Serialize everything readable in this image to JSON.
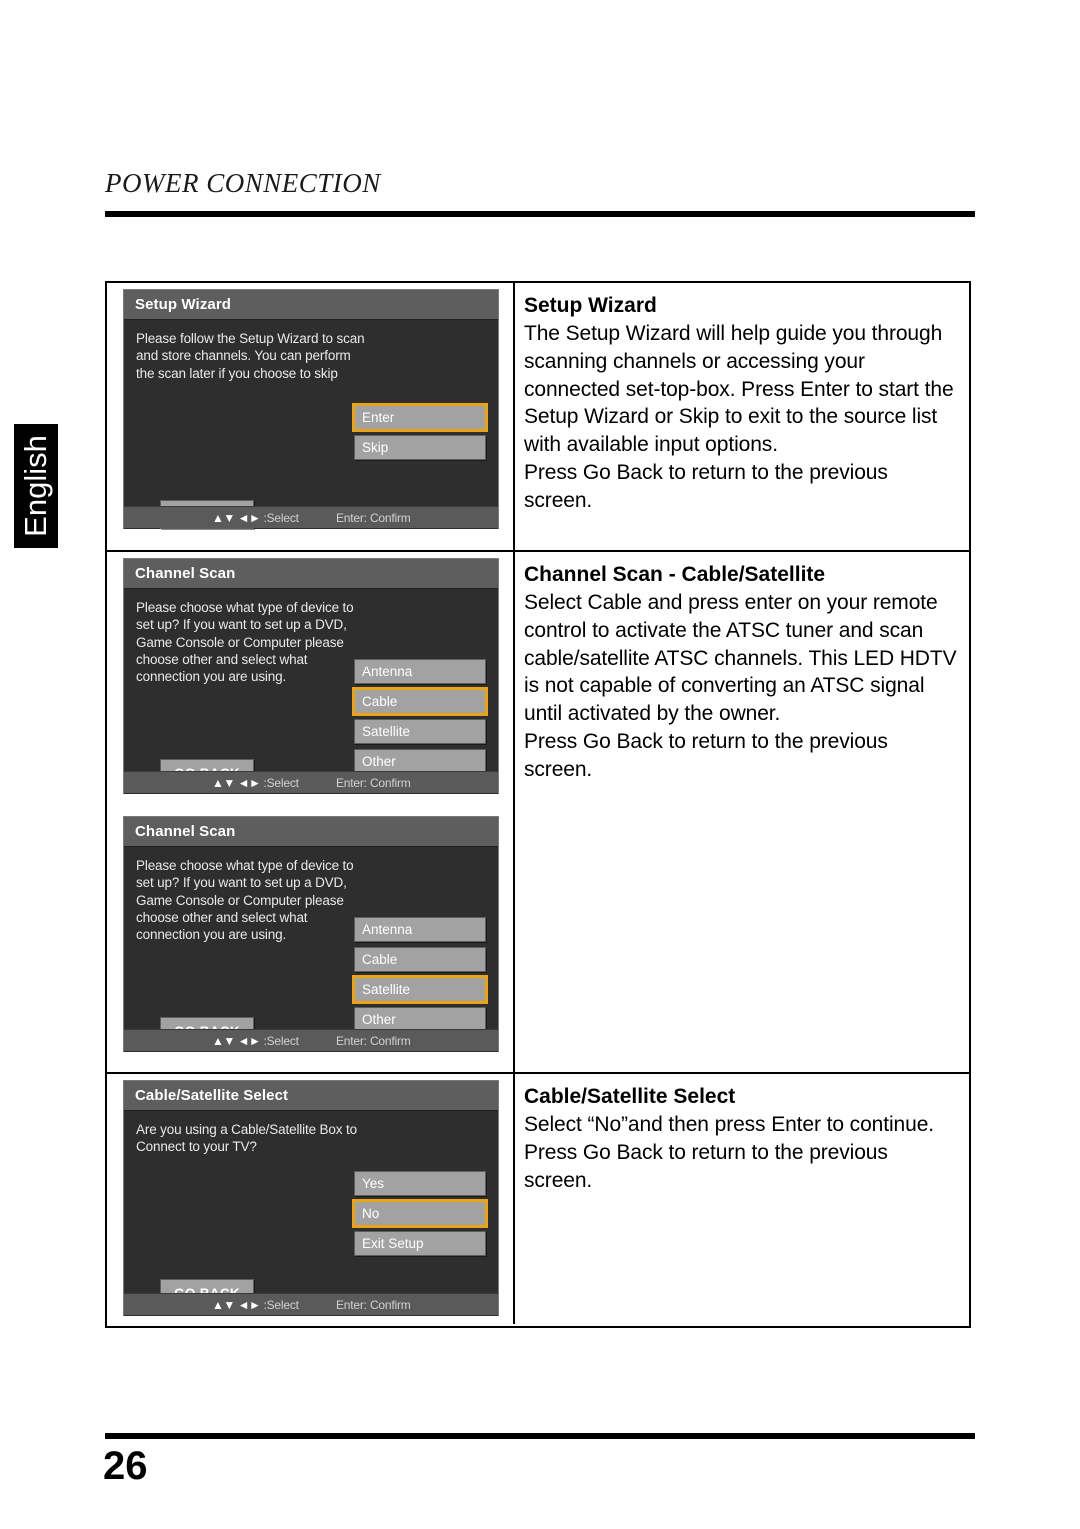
{
  "page": {
    "section_header": "POWER CONNECTION",
    "language_tab": "English",
    "page_number": "26"
  },
  "osd_common": {
    "go_back_label": "GO BACK",
    "footer_arrows": "▲▼ ◄►",
    "footer_select": ":Select",
    "footer_confirm": "Enter: Confirm",
    "highlight_color": "#e8a317",
    "titlebar_color": "#5e5e5e",
    "body_color": "#2e2e2e",
    "button_color": "#a2a2a2"
  },
  "rows": [
    {
      "osd": {
        "title": "Setup Wizard",
        "body_text": "Please follow the Setup Wizard to scan and store channels.  You can perform the scan later if you choose to skip",
        "options": [
          {
            "label": "Enter",
            "selected": true
          },
          {
            "label": "Skip",
            "selected": false
          }
        ]
      },
      "description": {
        "heading": "Setup Wizard",
        "paragraph1": "The Setup Wizard will help guide you through scanning channels or accessing your connected set-top-box. Press Enter to start the Setup Wizard or Skip to exit to the source list with available input options.",
        "paragraph2": "Press Go Back to return to the previous screen."
      }
    },
    {
      "osd_a": {
        "title": "Channel Scan",
        "body_text": "Please choose what type of device to set up? If you want to set up a DVD, Game Console or Computer please choose other and select what connection you are using.",
        "options": [
          {
            "label": "Antenna",
            "selected": false
          },
          {
            "label": "Cable",
            "selected": true
          },
          {
            "label": "Satellite",
            "selected": false
          },
          {
            "label": "Other",
            "selected": false
          }
        ]
      },
      "osd_b": {
        "title": "Channel Scan",
        "body_text": "Please choose what type of device to set up? If you want to set up a DVD, Game Console or Computer please choose other and select what connection you are using.",
        "options": [
          {
            "label": "Antenna",
            "selected": false
          },
          {
            "label": "Cable",
            "selected": false
          },
          {
            "label": "Satellite",
            "selected": true
          },
          {
            "label": "Other",
            "selected": false
          }
        ]
      },
      "description": {
        "heading": "Channel Scan - Cable/Satellite",
        "paragraph1": "Select Cable and press enter on your remote control to activate the ATSC tuner and scan cable/satellite ATSC channels. This LED HDTV is not capable of converting an ATSC signal until activated by the owner.",
        "paragraph2": "Press Go Back to return to the previous screen."
      }
    },
    {
      "osd": {
        "title": "Cable/Satellite Select",
        "body_text": "Are you using a Cable/Satellite Box to Connect to your TV?",
        "options": [
          {
            "label": "Yes",
            "selected": false
          },
          {
            "label": "No",
            "selected": true
          },
          {
            "label": "Exit Setup",
            "selected": false
          }
        ]
      },
      "description": {
        "heading": "Cable/Satellite Select",
        "paragraph1": "Select “No”and then press Enter to continue.",
        "paragraph2": "Press Go Back to return to the previous screen."
      }
    }
  ]
}
